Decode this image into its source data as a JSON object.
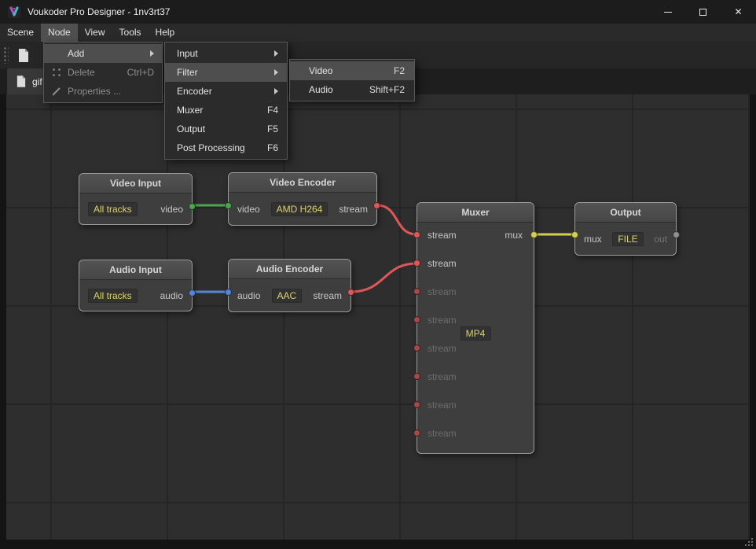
{
  "colors": {
    "wire-green": "#4aa54e",
    "wire-red": "#dd5858",
    "wire-red-dim": "#a34a4a",
    "wire-blue": "#5585d6",
    "wire-yellow": "#d6cf52",
    "port-gray": "#909090",
    "accent-yellow": "#dbd26e"
  },
  "titlebar": {
    "title": "Voukoder Pro Designer - 1nv3rt37",
    "close_icon": "✕"
  },
  "menubar": {
    "items": [
      "Scene",
      "Node",
      "View",
      "Tools",
      "Help"
    ]
  },
  "node_menu": {
    "add": {
      "label": "Add"
    },
    "delete": {
      "label": "Delete",
      "shortcut": "Ctrl+D"
    },
    "properties": {
      "label": "Properties ..."
    }
  },
  "add_submenu": {
    "input": {
      "label": "Input"
    },
    "filter": {
      "label": "Filter"
    },
    "encoder": {
      "label": "Encoder"
    },
    "muxer": {
      "label": "Muxer",
      "shortcut": "F4"
    },
    "output": {
      "label": "Output",
      "shortcut": "F5"
    },
    "post_processing": {
      "label": "Post Processing",
      "shortcut": "F6"
    }
  },
  "filter_submenu": {
    "video": {
      "label": "Video",
      "shortcut": "F2"
    },
    "audio": {
      "label": "Audio",
      "shortcut": "Shift+F2"
    }
  },
  "tab": {
    "label": "gif"
  },
  "graph": {
    "video_input": {
      "title": "Video Input",
      "value": "All tracks",
      "out_label": "video"
    },
    "video_encoder": {
      "title": "Video Encoder",
      "in_label": "video",
      "value": "AMD H264",
      "out_label": "stream"
    },
    "audio_input": {
      "title": "Audio Input",
      "value": "All tracks",
      "out_label": "audio"
    },
    "audio_encoder": {
      "title": "Audio Encoder",
      "in_label": "audio",
      "value": "AAC",
      "out_label": "stream"
    },
    "muxer": {
      "title": "Muxer",
      "value": "MP4",
      "out_label": "mux",
      "inputs": [
        "stream",
        "stream",
        "stream",
        "stream",
        "stream",
        "stream",
        "stream",
        "stream"
      ]
    },
    "output": {
      "title": "Output",
      "in_label": "mux",
      "value": "FILE",
      "out_label": "out"
    }
  }
}
